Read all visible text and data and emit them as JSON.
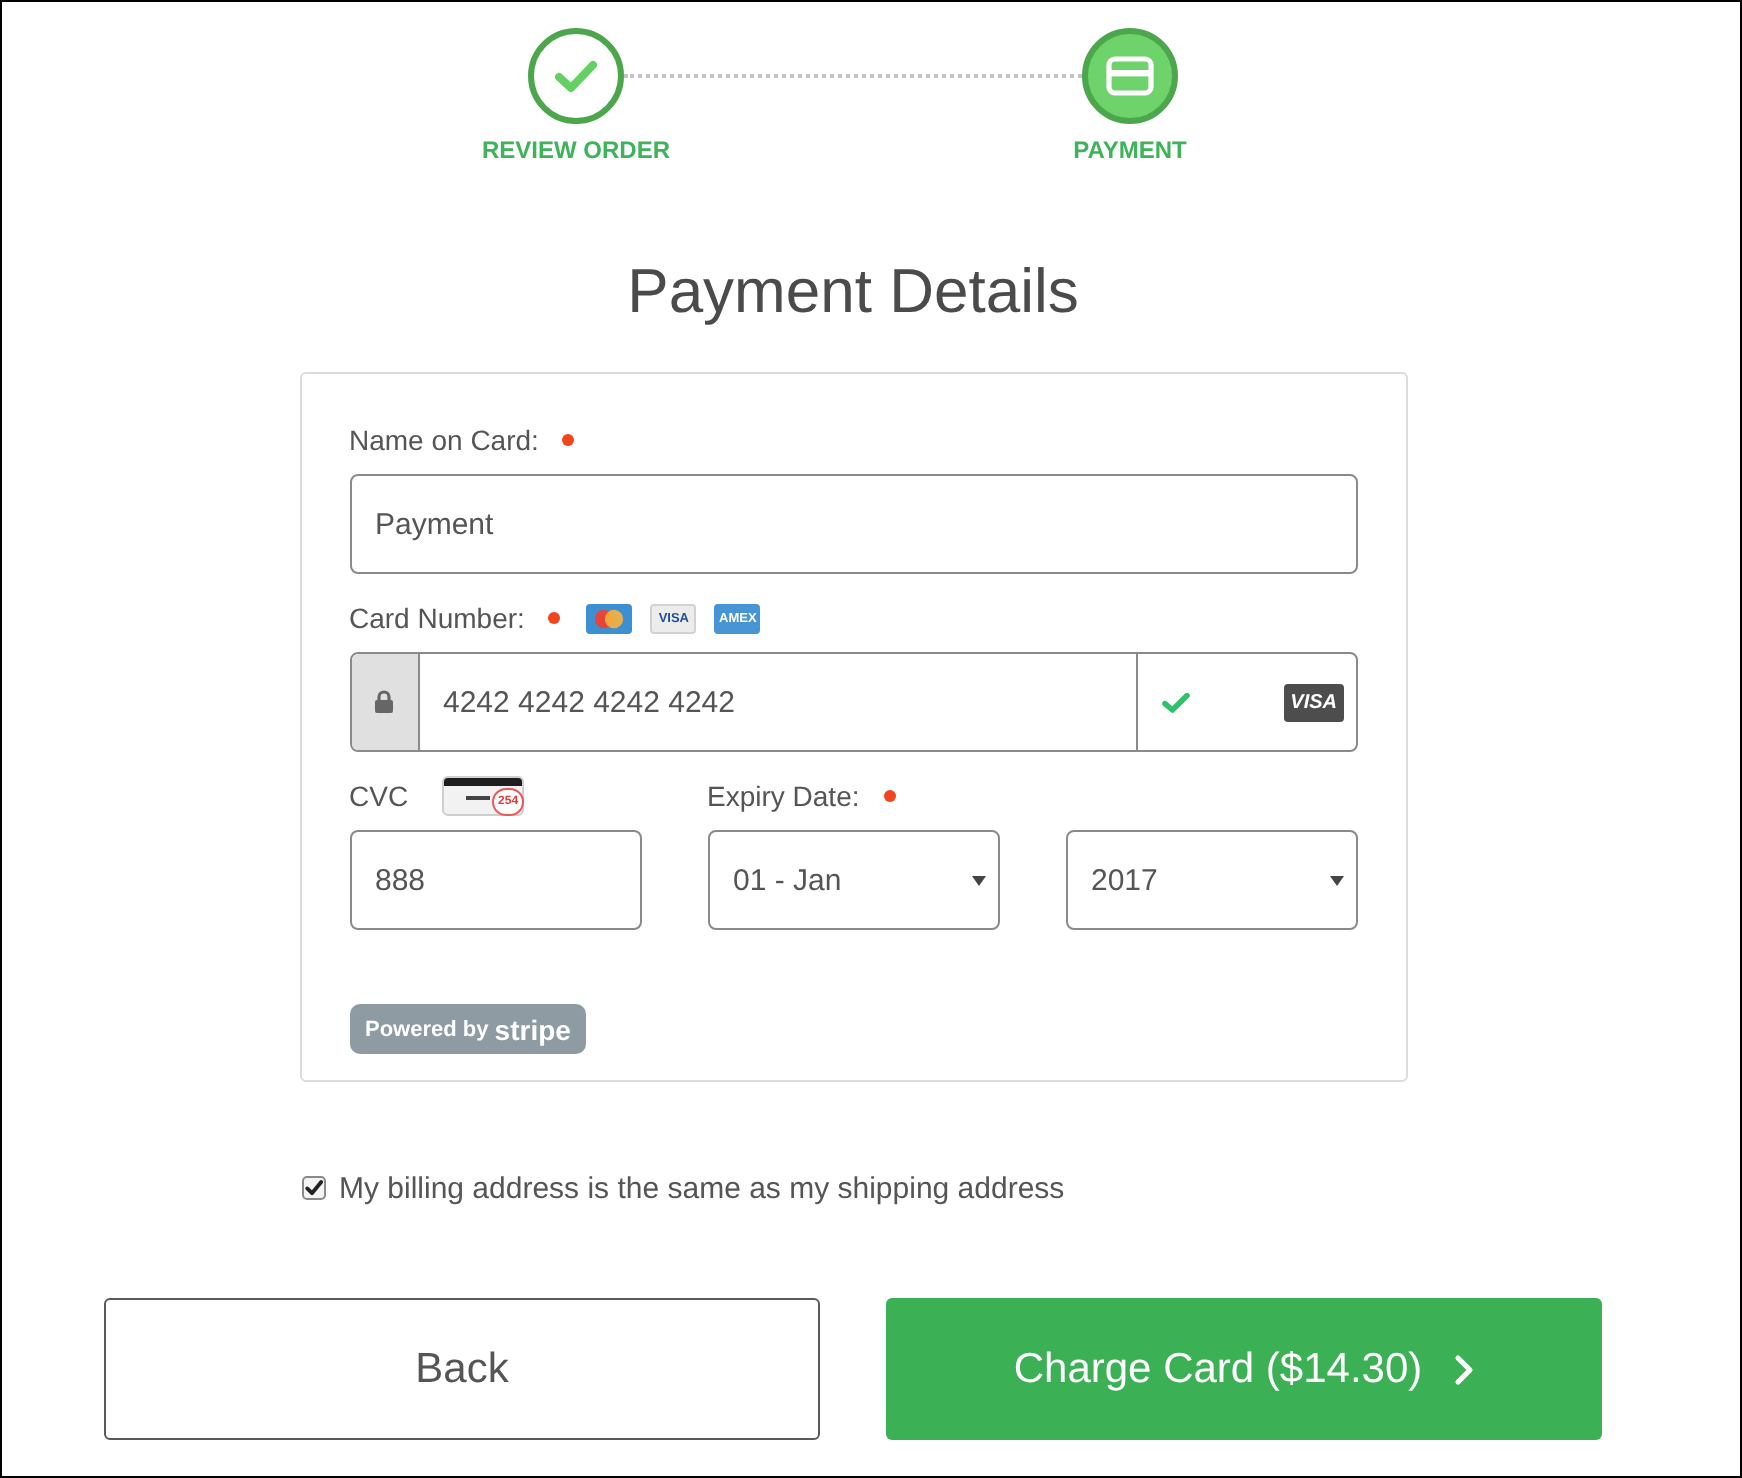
{
  "steps": [
    {
      "label": "REVIEW ORDER",
      "selected": false
    },
    {
      "label": "PAYMENT",
      "selected": true
    }
  ],
  "title": "Payment Details",
  "form": {
    "name_on_card": {
      "label": "Name on Card:",
      "required": true,
      "value": "Payment"
    },
    "card_number": {
      "label": "Card Number:",
      "required": true,
      "accepted_cards": [
        {
          "kind": "mastercard"
        },
        {
          "kind": "visa",
          "text": "VISA"
        },
        {
          "kind": "amex",
          "text": "AMEX"
        }
      ],
      "value": "4242 4242 4242 4242",
      "valid": true,
      "brand_badge": "VISA"
    },
    "cvc": {
      "label": "CVC",
      "hint_number": "254",
      "value": "888"
    },
    "expiry": {
      "label": "Expiry Date:",
      "required": true,
      "month": "01 - Jan",
      "year": "2017"
    },
    "powered_by": "Powered by **stripe**"
  },
  "billing_same": {
    "label": "My billing address is the same as my shipping address",
    "checked": true
  },
  "buttons": [
    {
      "label": "Back",
      "kind": "secondary"
    },
    {
      "label": "Charge Card ($14.30)",
      "kind": "primary"
    }
  ]
}
